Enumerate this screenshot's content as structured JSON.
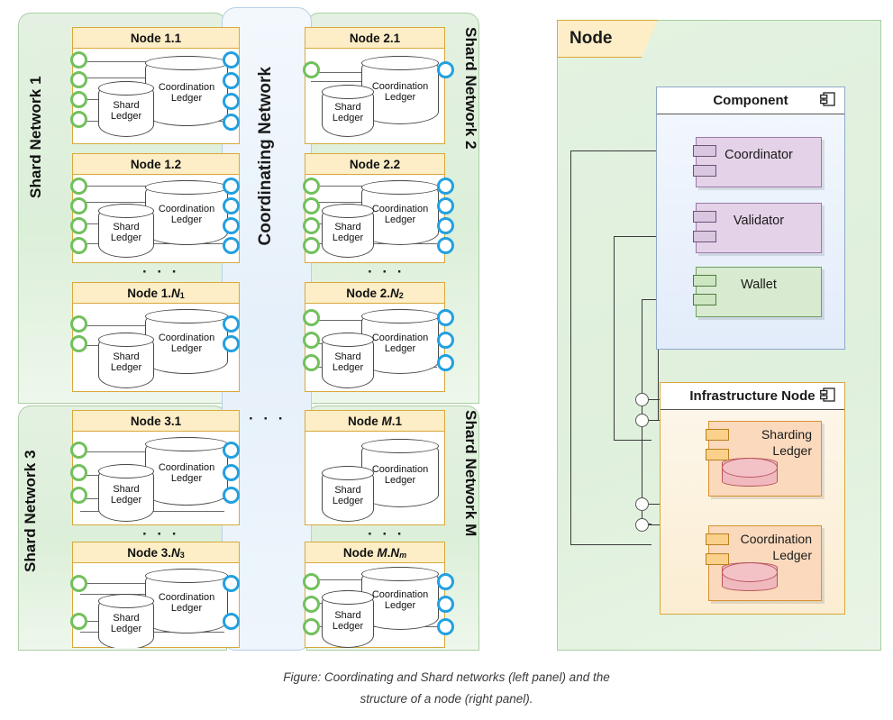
{
  "caption": {
    "line1": "Figure: Coordinating and Shard networks (left panel) and the",
    "line2": "structure of a node (right panel)."
  },
  "left_panel": {
    "coordinating_network_label": "Coordinating Network",
    "shard_networks": [
      {
        "id": "sn1",
        "label": "Shard Network 1",
        "orientation": "up"
      },
      {
        "id": "sn2",
        "label": "Shard Network 2",
        "orientation": "down"
      },
      {
        "id": "sn3",
        "label": "Shard Network 3",
        "orientation": "up"
      },
      {
        "id": "snM",
        "label": "Shard Network M",
        "orientation": "down"
      }
    ],
    "ellipsis": "· · ·",
    "ledger_labels": {
      "shard": "Shard\nLedger",
      "shard_line1": "Shard",
      "shard_line2": "Ledger",
      "coordination_line1": "Coordination",
      "coordination_line2": "Ledger"
    },
    "nodes": [
      {
        "id": "n11",
        "title": "Node 1.1",
        "green_ports": 4,
        "blue_ports": 4
      },
      {
        "id": "n12",
        "title": "Node 1.2",
        "green_ports": 4,
        "blue_ports": 4
      },
      {
        "id": "n1N",
        "title": "Node 1.N1",
        "green_ports": 2,
        "blue_ports": 2
      },
      {
        "id": "n21",
        "title": "Node 2.1",
        "green_ports": 1,
        "blue_ports": 1
      },
      {
        "id": "n22",
        "title": "Node 2.2",
        "green_ports": 4,
        "blue_ports": 4
      },
      {
        "id": "n2N",
        "title": "Node 2.N2",
        "green_ports": 3,
        "blue_ports": 3
      },
      {
        "id": "n31",
        "title": "Node 3.1",
        "green_ports": 3,
        "blue_ports": 3
      },
      {
        "id": "n3N",
        "title": "Node 3.N3",
        "green_ports": 2,
        "blue_ports": 2
      },
      {
        "id": "nM1",
        "title": "Node M.1",
        "green_ports": 0,
        "blue_ports": 0
      },
      {
        "id": "nMN",
        "title": "Node M.Nm",
        "green_ports": 3,
        "blue_ports": 3
      }
    ]
  },
  "right_panel": {
    "node_label": "Node",
    "component_group": {
      "title": "Component",
      "items": [
        {
          "name": "Coordinator",
          "color": "#e4d3e8",
          "ports": 2
        },
        {
          "name": "Validator",
          "color": "#e4d3e8",
          "ports": 2
        },
        {
          "name": "Wallet",
          "color": "#d8ebd0",
          "ports": 2
        }
      ]
    },
    "infrastructure_group": {
      "title": "Infrastructure Node",
      "items": [
        {
          "name_line1": "Sharding",
          "name_line2": "Ledger",
          "color": "#fbd9bd",
          "ports": 2
        },
        {
          "name_line1": "Coordination",
          "name_line2": "Ledger",
          "color": "#fbd9bd",
          "ports": 2
        }
      ]
    }
  },
  "colors": {
    "shard_band": "#dcefd9",
    "shard_border": "#a9cfa3",
    "coord_band": "#e6f0fa",
    "coord_border": "#b6cfe6",
    "node_border": "#d8a93a",
    "node_header": "#fdeec7",
    "green_port": "#72c05c",
    "blue_port": "#23a0e0",
    "component_purple": "#e4d3e8",
    "component_green": "#d8ebd0",
    "ledger_orange": "#fbd9bd",
    "ledger_cylinder": "#f0b9bd"
  }
}
